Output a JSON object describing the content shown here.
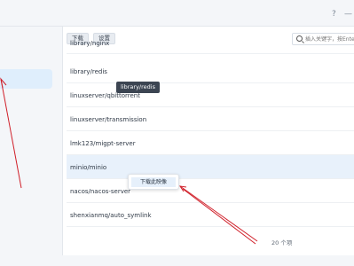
{
  "titlebar": {
    "help": "?",
    "minimize": "—"
  },
  "toolbar": {
    "download_label": "下载",
    "settings_label": "设置"
  },
  "search": {
    "placeholder": "插入关键字，按Enter"
  },
  "repos": [
    "library/nginx",
    "library/redis",
    "linuxserver/qbittorrent",
    "linuxserver/transmission",
    "lmk123/migpt-server",
    "minio/minio",
    "nacos/nacos-server",
    "shenxianmq/auto_symlink"
  ],
  "tooltip": {
    "text": "library/redis"
  },
  "context_menu": {
    "download_image": "下载此映像"
  },
  "footer": {
    "count": "20 个项"
  },
  "colors": {
    "annotation": "#d0202a",
    "selection": "#e8f1fb"
  }
}
